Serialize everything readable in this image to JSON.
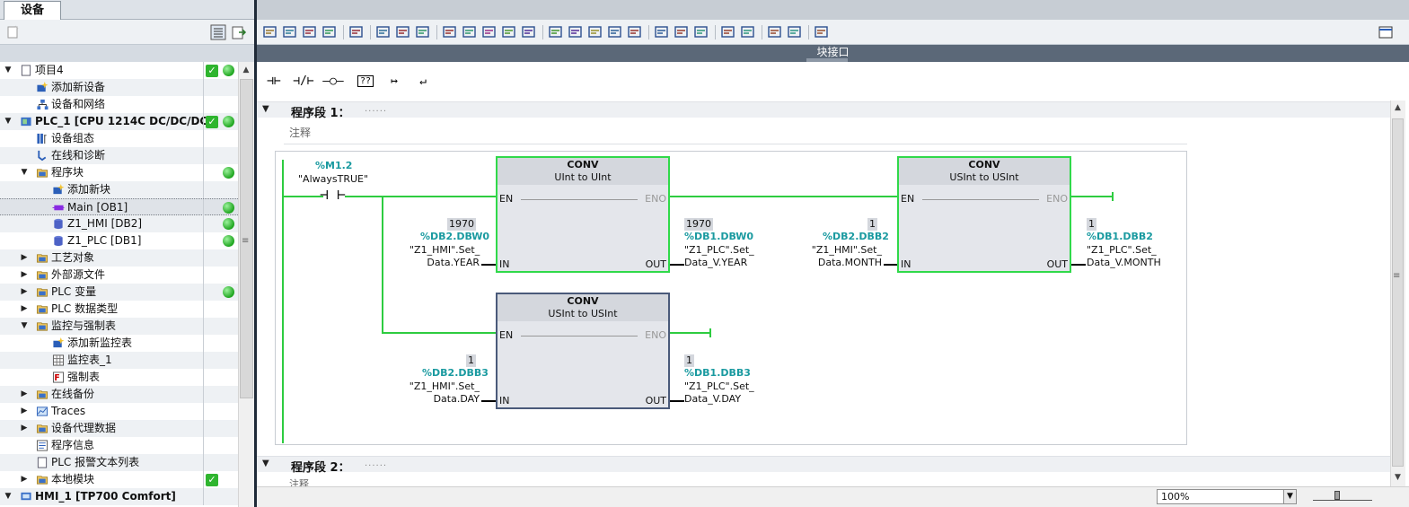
{
  "left_panel": {
    "tab": "设备",
    "tree": [
      {
        "label": "项目4",
        "check": true,
        "dot": true
      },
      {
        "label": "添加新设备"
      },
      {
        "label": "设备和网络"
      },
      {
        "label": "PLC_1 [CPU 1214C DC/DC/DC]",
        "check": true,
        "dot": true
      },
      {
        "label": "设备组态"
      },
      {
        "label": "在线和诊断"
      },
      {
        "label": "程序块",
        "dot": true
      },
      {
        "label": "添加新块"
      },
      {
        "label": "Main [OB1]",
        "dot": true
      },
      {
        "label": "Z1_HMI [DB2]",
        "dot": true
      },
      {
        "label": "Z1_PLC [DB1]",
        "dot": true
      },
      {
        "label": "工艺对象"
      },
      {
        "label": "外部源文件"
      },
      {
        "label": "PLC 变量",
        "dot": true
      },
      {
        "label": "PLC 数据类型"
      },
      {
        "label": "监控与强制表"
      },
      {
        "label": "添加新监控表"
      },
      {
        "label": "监控表_1"
      },
      {
        "label": "强制表"
      },
      {
        "label": "在线备份"
      },
      {
        "label": "Traces"
      },
      {
        "label": "设备代理数据"
      },
      {
        "label": "程序信息"
      },
      {
        "label": "PLC 报警文本列表"
      },
      {
        "label": "本地模块",
        "check": true
      },
      {
        "label": "HMI_1 [TP700 Comfort]"
      }
    ]
  },
  "editor": {
    "interface_bar": "块接口",
    "ladder_buttons": [
      "⊣⊢",
      "⊣/⊢",
      "—○—",
      "??",
      "↦",
      "↵"
    ],
    "networks": [
      {
        "title": "程序段 1：",
        "dots": "......",
        "comment": "注释"
      },
      {
        "title": "程序段 2：",
        "dots": "......",
        "comment": "注释"
      }
    ],
    "contact": {
      "addr": "%M1.2",
      "name": "\"AlwaysTRUE\""
    },
    "blocks": [
      {
        "title": "CONV",
        "types": "UInt  to  UInt",
        "en": "EN",
        "eno": "ENO",
        "in": "IN",
        "out": "OUT",
        "in_val": "1970",
        "in_addr": "%DB2.DBW0",
        "in_tag1": "\"Z1_HMI\".Set_",
        "in_tag2": "Data.YEAR",
        "out_val": "1970",
        "out_addr": "%DB1.DBW0",
        "out_tag1": "\"Z1_PLC\".Set_",
        "out_tag2": "Data_V.YEAR"
      },
      {
        "title": "CONV",
        "types": "USInt  to  USInt",
        "en": "EN",
        "eno": "ENO",
        "in": "IN",
        "out": "OUT",
        "in_val": "1",
        "in_addr": "%DB2.DBB2",
        "in_tag1": "\"Z1_HMI\".Set_",
        "in_tag2": "Data.MONTH",
        "out_val": "1",
        "out_addr": "%DB1.DBB2",
        "out_tag1": "\"Z1_PLC\".Set_",
        "out_tag2": "Data_V.MONTH"
      },
      {
        "title": "CONV",
        "types": "USInt  to  USInt",
        "en": "EN",
        "eno": "ENO",
        "in": "IN",
        "out": "OUT",
        "in_val": "1",
        "in_addr": "%DB2.DBB3",
        "in_tag1": "\"Z1_HMI\".Set_",
        "in_tag2": "Data.DAY",
        "out_val": "1",
        "out_addr": "%DB1.DBB3",
        "out_tag1": "\"Z1_PLC\".Set_",
        "out_tag2": "Data_V.DAY"
      }
    ],
    "zoom": "100%"
  }
}
